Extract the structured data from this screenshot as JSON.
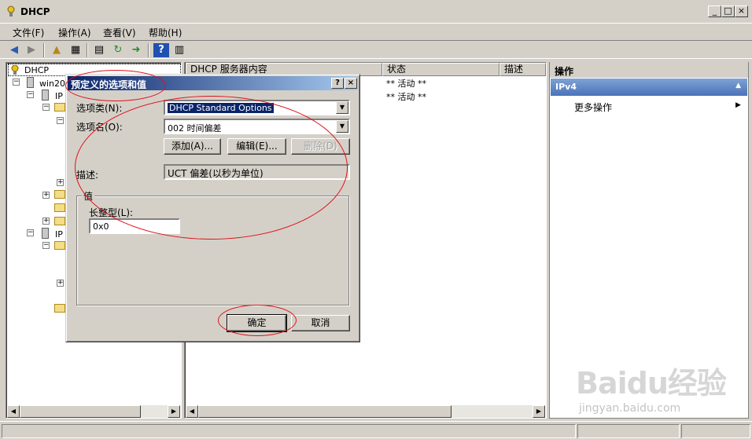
{
  "window": {
    "title": "DHCP",
    "minimize": "_",
    "maximize": "□",
    "close": "×"
  },
  "menu": [
    {
      "label": "文件(F)"
    },
    {
      "label": "操作(A)"
    },
    {
      "label": "查看(V)"
    },
    {
      "label": "帮助(H)"
    }
  ],
  "toolbar": {
    "icons": [
      "back-arrow-icon",
      "forward-arrow-icon",
      "up-folder-icon",
      "show-hide-tree-icon",
      "properties-icon",
      "refresh-icon",
      "export-icon",
      "help-icon",
      "extra-pane-icon"
    ]
  },
  "tree": {
    "header": "DHCP",
    "items": [
      {
        "label": "win200"
      },
      {
        "label": "IP"
      },
      {
        "label": "IP"
      }
    ]
  },
  "list": {
    "columns": [
      "DHCP 服务器内容",
      "状态",
      "描述"
    ],
    "rows": [
      {
        "status": "** 活动 **"
      },
      {
        "status": "** 活动 **"
      }
    ]
  },
  "actions": {
    "header": "操作",
    "section": "IPv4",
    "more": "更多操作"
  },
  "dialog": {
    "title": "预定义的选项和值",
    "help_btn": "?",
    "close_btn": "×",
    "option_class_label": "选项类(N):",
    "option_class_value": "DHCP Standard Options",
    "option_name_label": "选项名(O):",
    "option_name_value": "002 时间偏差",
    "add_btn": "添加(A)...",
    "edit_btn": "编辑(E)...",
    "delete_btn": "删除(D)",
    "desc_label": "描述:",
    "desc_value": "UCT 偏差(以秒为单位)",
    "value_group": "值",
    "long_label": "长整型(L):",
    "long_value": "0x0",
    "ok_btn": "确定",
    "cancel_btn": "取消"
  },
  "watermark": {
    "logo": "Baidu经验",
    "url": "jingyan.baidu.com"
  },
  "annotation_color": "#e0101a",
  "title_gradient": [
    "#0a246a",
    "#a6caf0"
  ]
}
